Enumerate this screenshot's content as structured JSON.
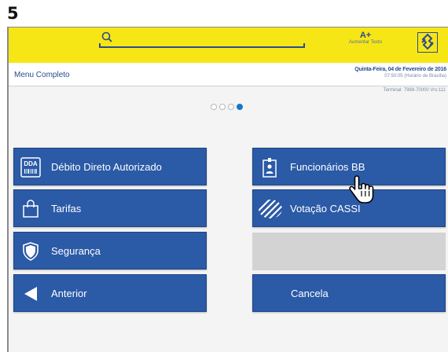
{
  "step": {
    "number": "5"
  },
  "header": {
    "search_placeholder": "",
    "font_size_button": {
      "label": "A+",
      "caption": "Aumentar Texto"
    },
    "logo_icon": "banco-do-brasil-logo-icon"
  },
  "subbar": {
    "menu_title": "Menu Completo",
    "date": "Quinta-Feira, 04 de Fevereiro de 2016",
    "time": "07:50:05 (Horário de Brasília)",
    "terminal": "Terminal: 7988-70000 Vrs:111"
  },
  "pager": {
    "pages": 4,
    "active_page": 4
  },
  "buttons": {
    "dda": {
      "icon_text": "DDA",
      "label": "Débito Direto Autorizado"
    },
    "tarifas": {
      "label": "Tarifas"
    },
    "seguranca": {
      "label": "Segurança"
    },
    "anterior": {
      "label": "Anterior"
    },
    "funcionarios": {
      "label": "Funcionários BB"
    },
    "votacao": {
      "label": "Votação CASSI"
    },
    "cancela": {
      "label": "Cancela"
    }
  },
  "colors": {
    "header_yellow": "#f7e616",
    "button_blue": "#2b5aa6",
    "brand_blue": "#2c4b8e",
    "active_dot": "#1676c8"
  }
}
